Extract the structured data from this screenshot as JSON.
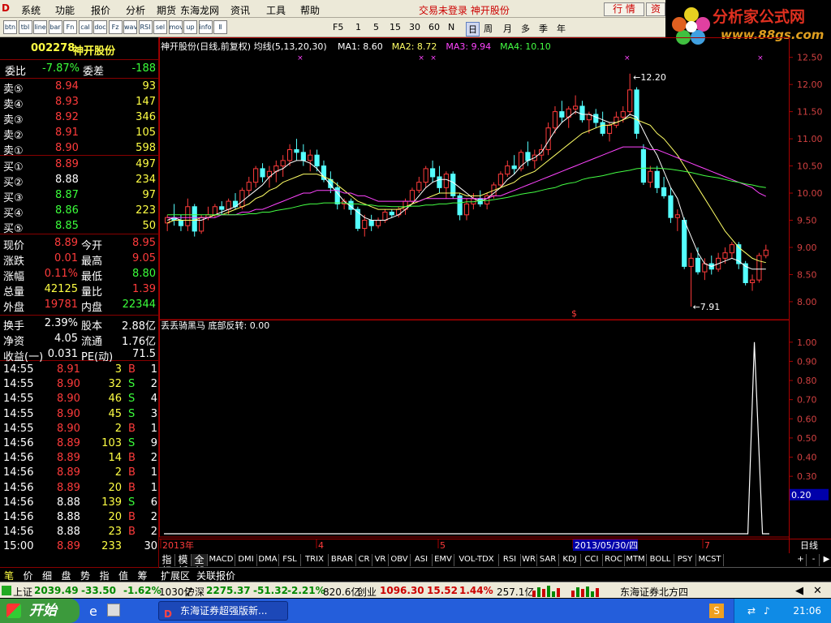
{
  "menu": {
    "items": [
      "系统",
      "功能",
      "报价",
      "分析",
      "期货",
      "东海龙网",
      "资讯",
      "工具",
      "帮助"
    ],
    "status": "交易未登录  神开股份",
    "buttons": [
      "行 情",
      "资"
    ]
  },
  "brand": {
    "title": "分析家公式网",
    "url": "www.88gs.com"
  },
  "toolbar": {
    "periods": [
      "F5",
      "1",
      "5",
      "15",
      "30",
      "60",
      "N",
      "日",
      "周",
      "月",
      "多",
      "季",
      "年"
    ],
    "icons": [
      "btn",
      "tbl",
      "line",
      "bar",
      "Fn",
      "cal",
      "doc",
      "Fz",
      "wave",
      "RSI",
      "sel",
      "move",
      "up",
      "info",
      "Ⅱ"
    ]
  },
  "quote": {
    "code": "002278",
    "name": "神开股份",
    "wb": {
      "label": "委比",
      "value": "-7.87%",
      "label2": "委差",
      "value2": "-188"
    },
    "sell": [
      {
        "l": "卖⑤",
        "p": "8.94",
        "v": "93"
      },
      {
        "l": "卖④",
        "p": "8.93",
        "v": "147"
      },
      {
        "l": "卖③",
        "p": "8.92",
        "v": "346"
      },
      {
        "l": "卖②",
        "p": "8.91",
        "v": "105"
      },
      {
        "l": "卖①",
        "p": "8.90",
        "v": "598"
      }
    ],
    "buy": [
      {
        "l": "买①",
        "p": "8.89",
        "v": "497"
      },
      {
        "l": "买②",
        "p": "8.88",
        "v": "234"
      },
      {
        "l": "买③",
        "p": "8.87",
        "v": "97"
      },
      {
        "l": "买④",
        "p": "8.86",
        "v": "223"
      },
      {
        "l": "买⑤",
        "p": "8.85",
        "v": "50"
      }
    ],
    "stats": [
      {
        "a": "现价",
        "av": "8.89",
        "b": "今开",
        "bv": "8.95"
      },
      {
        "a": "涨跌",
        "av": "0.01",
        "b": "最高",
        "bv": "9.05"
      },
      {
        "a": "涨幅",
        "av": "0.11%",
        "b": "最低",
        "bv": "8.80"
      },
      {
        "a": "总量",
        "av": "42125",
        "b": "量比",
        "bv": "1.39"
      },
      {
        "a": "外盘",
        "av": "19781",
        "b": "内盘",
        "bv": "22344"
      },
      {
        "a": "换手",
        "av": "2.39%",
        "b": "股本",
        "bv": "2.88亿"
      },
      {
        "a": "净资",
        "av": "4.05",
        "b": "流通",
        "bv": "1.76亿"
      },
      {
        "a": "收益(一)",
        "av": "0.031",
        "b": "PE(动)",
        "bv": "71.5"
      }
    ],
    "ticks": [
      {
        "t": "14:55",
        "p": "8.91",
        "v": "3",
        "s": "B",
        "n": "1"
      },
      {
        "t": "14:55",
        "p": "8.90",
        "v": "32",
        "s": "S",
        "n": "2"
      },
      {
        "t": "14:55",
        "p": "8.90",
        "v": "46",
        "s": "S",
        "n": "4"
      },
      {
        "t": "14:55",
        "p": "8.90",
        "v": "45",
        "s": "S",
        "n": "3"
      },
      {
        "t": "14:55",
        "p": "8.90",
        "v": "2",
        "s": "B",
        "n": "1"
      },
      {
        "t": "14:56",
        "p": "8.89",
        "v": "103",
        "s": "S",
        "n": "9"
      },
      {
        "t": "14:56",
        "p": "8.89",
        "v": "14",
        "s": "B",
        "n": "2"
      },
      {
        "t": "14:56",
        "p": "8.89",
        "v": "2",
        "s": "B",
        "n": "1"
      },
      {
        "t": "14:56",
        "p": "8.89",
        "v": "20",
        "s": "B",
        "n": "1"
      },
      {
        "t": "14:56",
        "p": "8.88",
        "v": "139",
        "s": "S",
        "n": "6"
      },
      {
        "t": "14:56",
        "p": "8.88",
        "v": "20",
        "s": "B",
        "n": "2"
      },
      {
        "t": "14:56",
        "p": "8.88",
        "v": "23",
        "s": "B",
        "n": "2"
      },
      {
        "t": "15:00",
        "p": "8.89",
        "v": "233",
        "s": "",
        "n": "30"
      }
    ]
  },
  "chart": {
    "header": "神开股份(日线,前复权) 均线(5,13,20,30)",
    "ma": [
      {
        "label": "MA1: 8.60",
        "color": "#ffffff"
      },
      {
        "label": "MA2: 8.72",
        "color": "#ffff66"
      },
      {
        "label": "MA3: 9.94",
        "color": "#ff44ff"
      },
      {
        "label": "MA4: 10.10",
        "color": "#44ff44"
      }
    ],
    "yticks": [
      "12.50",
      "12.00",
      "11.50",
      "11.00",
      "10.50",
      "10.00",
      "9.50",
      "9.00",
      "8.50",
      "8.00"
    ],
    "high_label": "12.20",
    "low_label": "7.91",
    "sub_header": "丢丢骑黑马  底部反转: 0.00",
    "sub_yticks": [
      "1.00",
      "0.90",
      "0.80",
      "0.70",
      "0.60",
      "0.50",
      "0.40",
      "0.30",
      "0.20"
    ],
    "sub_current": "0.20",
    "xlabels": [
      "2013年",
      "4",
      "5",
      "2013/05/30/四",
      "7"
    ],
    "period_label": "日线"
  },
  "chart_data": {
    "type": "candlestick",
    "title": "神开股份(日线,前复权)",
    "ylim": [
      7.7,
      12.6
    ],
    "sub_ylim": [
      0,
      1.05
    ],
    "indicator_peak": 1.0,
    "candles": [
      [
        9.45,
        9.6,
        9.3,
        9.55
      ],
      [
        9.55,
        9.8,
        9.4,
        9.5
      ],
      [
        9.5,
        9.6,
        9.3,
        9.4
      ],
      [
        9.4,
        9.9,
        9.3,
        9.75
      ],
      [
        9.75,
        9.8,
        9.2,
        9.3
      ],
      [
        9.3,
        9.6,
        9.25,
        9.55
      ],
      [
        9.55,
        9.75,
        9.5,
        9.6
      ],
      [
        9.6,
        9.8,
        9.55,
        9.75
      ],
      [
        9.75,
        9.85,
        9.6,
        9.7
      ],
      [
        9.7,
        9.9,
        9.6,
        9.85
      ],
      [
        9.85,
        10.0,
        9.7,
        9.75
      ],
      [
        9.75,
        10.1,
        9.7,
        10.05
      ],
      [
        10.05,
        10.3,
        9.95,
        10.2
      ],
      [
        10.2,
        10.5,
        10.1,
        10.45
      ],
      [
        10.45,
        10.55,
        10.2,
        10.3
      ],
      [
        10.3,
        10.5,
        10.1,
        10.4
      ],
      [
        10.4,
        10.6,
        10.2,
        10.5
      ],
      [
        10.5,
        10.7,
        10.3,
        10.6
      ],
      [
        10.6,
        10.9,
        10.5,
        10.8
      ],
      [
        10.8,
        11.0,
        10.6,
        10.75
      ],
      [
        10.75,
        10.9,
        10.5,
        10.6
      ],
      [
        10.6,
        10.8,
        10.4,
        10.7
      ],
      [
        10.7,
        10.8,
        10.4,
        10.5
      ],
      [
        10.5,
        10.6,
        10.2,
        10.25
      ],
      [
        10.25,
        10.4,
        10.0,
        10.1
      ],
      [
        10.1,
        10.2,
        9.7,
        9.8
      ],
      [
        9.8,
        9.9,
        9.7,
        9.85
      ],
      [
        9.85,
        9.9,
        9.6,
        9.7
      ],
      [
        9.7,
        9.75,
        9.3,
        9.35
      ],
      [
        9.35,
        9.6,
        9.2,
        9.5
      ],
      [
        9.5,
        9.6,
        9.3,
        9.4
      ],
      [
        9.4,
        9.55,
        9.35,
        9.5
      ],
      [
        9.5,
        9.7,
        9.45,
        9.65
      ],
      [
        9.65,
        9.7,
        9.55,
        9.6
      ],
      [
        9.6,
        9.75,
        9.55,
        9.7
      ],
      [
        9.7,
        9.9,
        9.6,
        9.85
      ],
      [
        9.85,
        10.1,
        9.8,
        10.05
      ],
      [
        10.05,
        10.3,
        10.0,
        10.2
      ],
      [
        10.2,
        10.5,
        10.1,
        10.45
      ],
      [
        10.45,
        10.6,
        10.2,
        10.3
      ],
      [
        10.3,
        10.5,
        10.0,
        10.1
      ],
      [
        10.1,
        10.4,
        9.9,
        10.35
      ],
      [
        10.35,
        10.4,
        9.9,
        9.95
      ],
      [
        9.95,
        10.0,
        9.5,
        9.6
      ],
      [
        9.6,
        9.9,
        9.5,
        9.8
      ],
      [
        9.8,
        10.0,
        9.7,
        9.9
      ],
      [
        9.9,
        10.05,
        9.75,
        9.8
      ],
      [
        9.8,
        10.0,
        9.7,
        9.95
      ],
      [
        9.95,
        10.2,
        9.9,
        10.15
      ],
      [
        10.15,
        10.4,
        10.1,
        10.35
      ],
      [
        10.35,
        10.6,
        10.3,
        10.5
      ],
      [
        10.5,
        10.7,
        10.35,
        10.45
      ],
      [
        10.45,
        10.8,
        10.4,
        10.75
      ],
      [
        10.75,
        10.95,
        10.5,
        10.6
      ],
      [
        10.6,
        10.8,
        10.45,
        10.7
      ],
      [
        10.7,
        10.9,
        10.6,
        10.8
      ],
      [
        10.8,
        11.3,
        10.7,
        11.2
      ],
      [
        11.2,
        11.6,
        11.1,
        11.5
      ],
      [
        11.5,
        11.7,
        11.3,
        11.4
      ],
      [
        11.4,
        11.6,
        11.2,
        11.55
      ],
      [
        11.55,
        11.8,
        11.45,
        11.6
      ],
      [
        11.6,
        11.7,
        11.3,
        11.35
      ],
      [
        11.35,
        11.5,
        11.1,
        11.45
      ],
      [
        11.45,
        11.55,
        11.2,
        11.3
      ],
      [
        11.3,
        11.5,
        11.05,
        11.1
      ],
      [
        11.1,
        11.3,
        10.95,
        11.25
      ],
      [
        11.25,
        11.5,
        11.2,
        11.4
      ],
      [
        11.4,
        11.6,
        11.3,
        11.5
      ],
      [
        11.5,
        12.2,
        11.45,
        11.9
      ],
      [
        11.9,
        11.95,
        11.0,
        11.1
      ],
      [
        10.8,
        10.9,
        10.15,
        10.2
      ],
      [
        10.2,
        10.5,
        10.1,
        10.4
      ],
      [
        10.4,
        10.5,
        10.0,
        10.1
      ],
      [
        10.1,
        10.3,
        9.9,
        9.95
      ],
      [
        9.95,
        10.1,
        9.45,
        9.55
      ],
      [
        9.55,
        9.7,
        9.3,
        9.6
      ],
      [
        9.5,
        9.55,
        8.6,
        8.65
      ],
      [
        8.65,
        8.9,
        7.91,
        8.8
      ],
      [
        8.8,
        9.0,
        8.5,
        8.55
      ],
      [
        8.55,
        8.8,
        8.4,
        8.7
      ],
      [
        8.7,
        8.85,
        8.5,
        8.6
      ],
      [
        8.6,
        8.9,
        8.55,
        8.8
      ],
      [
        8.8,
        9.0,
        8.7,
        8.9
      ],
      [
        8.9,
        9.1,
        8.8,
        9.05
      ],
      [
        9.05,
        9.1,
        8.6,
        8.7
      ],
      [
        8.7,
        8.75,
        8.3,
        8.35
      ],
      [
        8.35,
        8.5,
        8.2,
        8.4
      ],
      [
        8.4,
        8.9,
        8.35,
        8.85
      ],
      [
        8.85,
        9.05,
        8.8,
        8.95
      ]
    ],
    "ma_lines": [
      {
        "name": "MA1",
        "color": "#ffffff",
        "values": [
          9.5,
          9.55,
          9.5,
          9.5,
          9.5,
          9.5,
          9.55,
          9.6,
          9.65,
          9.7,
          9.75,
          9.85,
          9.95,
          10.05,
          10.15,
          10.3,
          10.4,
          10.45,
          10.55,
          10.6,
          10.6,
          10.55,
          10.45,
          10.3,
          10.15,
          10.0,
          9.85,
          9.75,
          9.65,
          9.55,
          9.5,
          9.5,
          9.5,
          9.55,
          9.6,
          9.7,
          9.8,
          9.95,
          10.1,
          10.2,
          10.25,
          10.25,
          10.2,
          10.1,
          10.0,
          9.9,
          9.85,
          9.9,
          10.0,
          10.1,
          10.25,
          10.35,
          10.5,
          10.6,
          10.65,
          10.75,
          10.95,
          11.15,
          11.3,
          11.4,
          11.5,
          11.45,
          11.45,
          11.4,
          11.35,
          11.3,
          11.3,
          11.35,
          11.45,
          11.4,
          11.15,
          10.9,
          10.7,
          10.4,
          10.1,
          9.9,
          9.5,
          9.2,
          8.9,
          8.7,
          8.65,
          8.7,
          8.75,
          8.8,
          8.75,
          8.65,
          8.6,
          8.6,
          8.6
        ]
      },
      {
        "name": "MA2",
        "color": "#ffff66",
        "values": [
          9.45,
          9.5,
          9.5,
          9.5,
          9.5,
          9.55,
          9.55,
          9.6,
          9.6,
          9.65,
          9.7,
          9.75,
          9.8,
          9.9,
          9.95,
          10.05,
          10.1,
          10.2,
          10.25,
          10.3,
          10.35,
          10.35,
          10.35,
          10.3,
          10.25,
          10.15,
          10.05,
          9.95,
          9.85,
          9.8,
          9.75,
          9.7,
          9.7,
          9.7,
          9.7,
          9.75,
          9.8,
          9.85,
          9.9,
          9.95,
          10.0,
          10.0,
          10.0,
          10.0,
          9.95,
          9.95,
          9.95,
          10.0,
          10.05,
          10.1,
          10.15,
          10.2,
          10.3,
          10.35,
          10.4,
          10.5,
          10.6,
          10.7,
          10.8,
          10.9,
          11.0,
          11.1,
          11.15,
          11.2,
          11.25,
          11.25,
          11.3,
          11.35,
          11.4,
          11.35,
          11.3,
          11.25,
          11.1,
          11.0,
          10.85,
          10.7,
          10.5,
          10.3,
          10.1,
          9.9,
          9.7,
          9.5,
          9.3,
          9.15,
          9.0,
          8.9,
          8.8,
          8.75,
          8.72
        ]
      },
      {
        "name": "MA3",
        "color": "#ff44ff",
        "values": [
          9.55,
          9.55,
          9.55,
          9.55,
          9.55,
          9.55,
          9.55,
          9.55,
          9.6,
          9.6,
          9.6,
          9.65,
          9.65,
          9.7,
          9.7,
          9.75,
          9.8,
          9.85,
          9.9,
          9.95,
          10.0,
          10.0,
          10.05,
          10.05,
          10.05,
          10.05,
          10.0,
          10.0,
          9.95,
          9.95,
          9.9,
          9.85,
          9.85,
          9.85,
          9.85,
          9.85,
          9.85,
          9.85,
          9.9,
          9.9,
          9.9,
          9.9,
          9.9,
          9.9,
          9.9,
          9.9,
          9.9,
          9.9,
          9.95,
          9.95,
          10.0,
          10.05,
          10.1,
          10.15,
          10.2,
          10.25,
          10.3,
          10.35,
          10.4,
          10.45,
          10.5,
          10.55,
          10.6,
          10.65,
          10.7,
          10.75,
          10.8,
          10.85,
          10.85,
          10.85,
          10.85,
          10.8,
          10.8,
          10.75,
          10.7,
          10.65,
          10.6,
          10.55,
          10.5,
          10.45,
          10.4,
          10.35,
          10.3,
          10.25,
          10.2,
          10.15,
          10.1,
          10.0,
          9.94
        ]
      },
      {
        "name": "MA4",
        "color": "#44ff44",
        "values": [
          9.6,
          9.6,
          9.6,
          9.6,
          9.6,
          9.6,
          9.6,
          9.6,
          9.6,
          9.6,
          9.6,
          9.6,
          9.62,
          9.62,
          9.65,
          9.65,
          9.68,
          9.7,
          9.72,
          9.75,
          9.78,
          9.8,
          9.8,
          9.82,
          9.82,
          9.82,
          9.82,
          9.8,
          9.8,
          9.78,
          9.78,
          9.76,
          9.76,
          9.75,
          9.75,
          9.75,
          9.76,
          9.76,
          9.78,
          9.78,
          9.8,
          9.8,
          9.82,
          9.82,
          9.84,
          9.84,
          9.86,
          9.86,
          9.88,
          9.9,
          9.92,
          9.95,
          9.98,
          10.0,
          10.02,
          10.05,
          10.08,
          10.1,
          10.15,
          10.18,
          10.2,
          10.25,
          10.28,
          10.3,
          10.32,
          10.35,
          10.38,
          10.4,
          10.42,
          10.45,
          10.46,
          10.46,
          10.46,
          10.45,
          10.44,
          10.42,
          10.4,
          10.38,
          10.35,
          10.32,
          10.3,
          10.28,
          10.25,
          10.22,
          10.2,
          10.17,
          10.15,
          10.12,
          10.1
        ]
      }
    ]
  },
  "bottom_tabs": [
    "指标",
    "模板",
    "全部",
    "MACD",
    "DMI",
    "DMA",
    "FSL",
    "TRIX",
    "BRAR",
    "CR",
    "VR",
    "OBV",
    "ASI",
    "EMV",
    "VOL-TDX",
    "RSI",
    "WR",
    "SAR",
    "KDJ",
    "CCI",
    "ROC",
    "MTM",
    "BOLL",
    "PSY",
    "MCST"
  ],
  "ext_tabs": [
    "扩展区",
    "关联报价"
  ],
  "left_tabs": [
    "笔",
    "价",
    "细",
    "盘",
    "势",
    "指",
    "值",
    "筹"
  ],
  "ticker": {
    "sh_label": "上证",
    "sh": "2039.49",
    "sh_chg": "-33.50",
    "sh_pct": "-1.62%",
    "sh_amt": "1030亿",
    "sz_label": "沪深",
    "sz": "2275.37",
    "sz_chg": "-51.32",
    "sz_pct": "-2.21%",
    "sz_amt": "820.6亿",
    "cy_label": "创业",
    "cy": "1096.30",
    "cy_chg": "15.52",
    "cy_pct": "1.44%",
    "cy_amt": "257.1亿",
    "broker": "东海证券北方四"
  },
  "taskbar": {
    "start": "开始",
    "task": "东海证券超强版新...",
    "clock": "21:06"
  }
}
